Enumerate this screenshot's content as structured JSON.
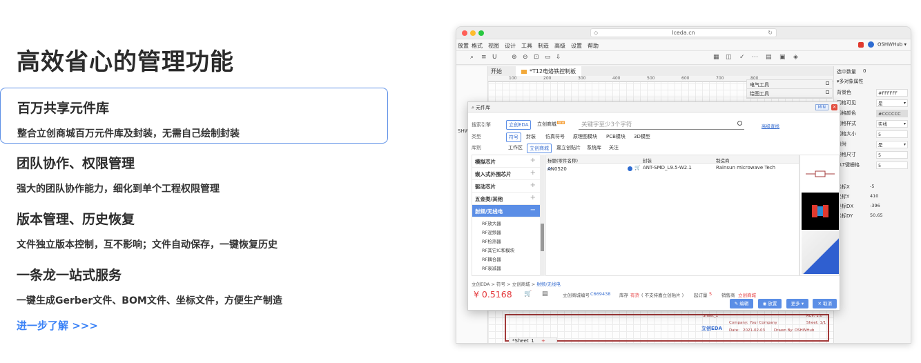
{
  "headline": "高效省心的管理功能",
  "features": [
    {
      "title": "百万共享元件库",
      "desc": "整合立创商城百万元件库及封装，无需自己绘制封装"
    },
    {
      "title": "团队协作、权限管理",
      "desc": "强大的团队协作能力，细化到单个工程权限管理"
    },
    {
      "title": "版本管理、历史恢复",
      "desc": "文件独立版本控制，互不影响；文件自动保存，一键恢复历史"
    },
    {
      "title": "一条龙一站式服务",
      "desc": "一键生成Gerber文件、BOM文件、坐标文件，方便生产制造"
    }
  ],
  "learn_more": "进一步了解 >>>",
  "browser": {
    "url": "lceda.cn",
    "menu": [
      "放置",
      "格式",
      "视图",
      "设计",
      "工具",
      "制造",
      "高级",
      "设置",
      "帮助"
    ],
    "user": "OSHWHub ▾",
    "tab_home": "开始",
    "tab_file": "*T12电烙铁控制板",
    "left_panel_label": "SHWHub",
    "ruler_ticks": [
      "100",
      "200",
      "300",
      "400",
      "500",
      "600",
      "700",
      "800"
    ],
    "tool_panels": [
      "电气工具",
      "绘图工具"
    ],
    "right_panel": {
      "selected_label": "选中数量",
      "selected_count": "0",
      "section": "多对象属性",
      "rows": [
        {
          "label": "背景色",
          "value": "#FFFFFF",
          "dropdown": false
        },
        {
          "label": "网格可见",
          "value": "是",
          "dropdown": true
        },
        {
          "label": "网格颜色",
          "value": "#CCCCCC",
          "dropdown": false
        },
        {
          "label": "网格样式",
          "value": "实线",
          "dropdown": true
        },
        {
          "label": "网格大小",
          "value": "5",
          "dropdown": false
        },
        {
          "label": "吸附",
          "value": "是",
          "dropdown": true
        },
        {
          "label": "栅格尺寸",
          "value": "5",
          "dropdown": false
        },
        {
          "label": "ALT键栅格",
          "value": "5",
          "dropdown": false
        }
      ],
      "coords": [
        {
          "label": "坐标X",
          "value": "-5"
        },
        {
          "label": "坐标Y",
          "value": "410"
        },
        {
          "label": "坐标DX",
          "value": "-396"
        },
        {
          "label": "坐标DY",
          "value": "50.65"
        }
      ]
    },
    "sheet_tab": "*Sheet_1",
    "title_block": {
      "sheet": "Sheet_1",
      "rev": "REV: 1.0",
      "company_label": "Company:",
      "company": "Your Company",
      "sheet_count": "Sheet: 1/1",
      "date_label": "Date:",
      "date": "2021-02-03",
      "drawn": "Drawn By: OSHWHub",
      "logo": "立创EDA"
    }
  },
  "dialog": {
    "title": "元件库",
    "min_label": "MIN",
    "engine_label": "搜索引擎",
    "engines": [
      "立创EDA",
      "立创商城"
    ],
    "hot_badge": "NEW",
    "search_placeholder": "关键字至少3个字符",
    "advanced_search": "高级查找",
    "type_label": "类型",
    "types": [
      "符号",
      "封装",
      "仿真符号",
      "原理图模块",
      "PCB模块",
      "3D模型"
    ],
    "lib_label": "库别",
    "libs": [
      "工作区",
      "立创商城",
      "嘉立创贴片",
      "系统库",
      "关注"
    ],
    "categories": [
      {
        "label": "模拟芯片",
        "active": false
      },
      {
        "label": "嵌入式外围芯片",
        "active": false
      },
      {
        "label": "驱动芯片",
        "active": false
      },
      {
        "label": "五金类/其他",
        "active": false
      },
      {
        "label": "射频/无线电",
        "active": true
      }
    ],
    "sub_categories": [
      "RF放大器",
      "RF混频器",
      "RF检测器",
      "RF其它IC和模块",
      "RF耦合器",
      "RF衰减器"
    ],
    "columns": [
      "标题(零件名称)",
      "封装",
      "制造商"
    ],
    "results": [
      {
        "title": "AN0520",
        "package": "ANT-SMD_L9.5-W2.1",
        "maker": "Rainsun microwave Tech"
      }
    ],
    "breadcrumb": [
      "立创EDA",
      "符号",
      "立创商城"
    ],
    "breadcrumb_current": "射频/无线电",
    "price": "¥ 0.5168",
    "mall_no_label": "立创商城编号",
    "mall_no": "C669438",
    "stock_label": "库存",
    "stock_value": "有货",
    "stock_note": "( 不支持嘉立创贴片 )",
    "moq_label": "起订量",
    "moq": "5",
    "seller_label": "销售商",
    "seller": "立创商城",
    "buttons": [
      "编辑",
      "放置",
      "更多 ▾",
      "取消"
    ]
  }
}
